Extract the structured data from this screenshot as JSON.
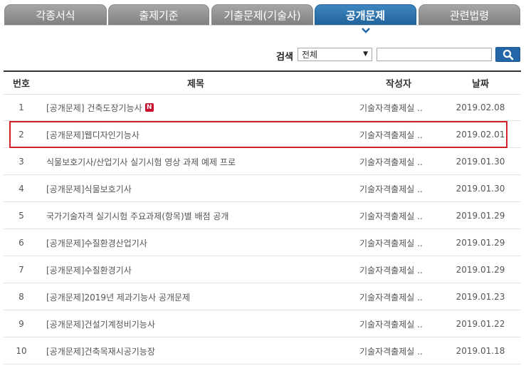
{
  "tabs": [
    {
      "label": "각종서식",
      "active": false
    },
    {
      "label": "출제기준",
      "active": false
    },
    {
      "label": "기출문제(기술사)",
      "active": false
    },
    {
      "label": "공개문제",
      "active": true
    },
    {
      "label": "관련법령",
      "active": false
    }
  ],
  "search": {
    "label": "검색",
    "select_value": "전체",
    "input_value": ""
  },
  "table": {
    "headers": {
      "num": "번호",
      "title": "제목",
      "author": "작성자",
      "date": "날짜"
    },
    "new_badge": "N",
    "rows": [
      {
        "num": "1",
        "title": "[공개문제] 건축도장기능사",
        "author": "기술자격출제실 ..",
        "date": "2019.02.08",
        "new": true
      },
      {
        "num": "2",
        "title": "[공개문제]웹디자인기능사",
        "author": "기술자격출제실 ..",
        "date": "2019.02.01"
      },
      {
        "num": "3",
        "title": "식물보호기사/산업기사 실기시험 영상 과제 예제 프로",
        "author": "기술자격출제실 ..",
        "date": "2019.01.30"
      },
      {
        "num": "4",
        "title": "[공개문제]식물보호기사",
        "author": "기술자격출제실 ..",
        "date": "2019.01.30"
      },
      {
        "num": "5",
        "title": "국가기술자격 실기시험 주요과제(항목)별 배점 공개",
        "author": "기술자격출제실 ..",
        "date": "2019.01.29"
      },
      {
        "num": "6",
        "title": "[공개문제]수질환경산업기사",
        "author": "기술자격출제실 ..",
        "date": "2019.01.29"
      },
      {
        "num": "7",
        "title": "[공개문제]수질환경기사",
        "author": "기술자격출제실 ..",
        "date": "2019.01.29"
      },
      {
        "num": "8",
        "title": "[공개문제]2019년 제과기능사 공개문제",
        "author": "기술자격출제실 ..",
        "date": "2019.01.23"
      },
      {
        "num": "9",
        "title": "[공개문제]건설기계정비기능사",
        "author": "기술자격출제실 ..",
        "date": "2019.01.22"
      },
      {
        "num": "10",
        "title": "[공개문제]건축목재시공기능장",
        "author": "기술자격출제실 ..",
        "date": "2019.01.18"
      }
    ]
  },
  "colors": {
    "accent": "#2566a8",
    "tab_inactive": "#8c8c8c",
    "highlight": "#d0202a"
  }
}
